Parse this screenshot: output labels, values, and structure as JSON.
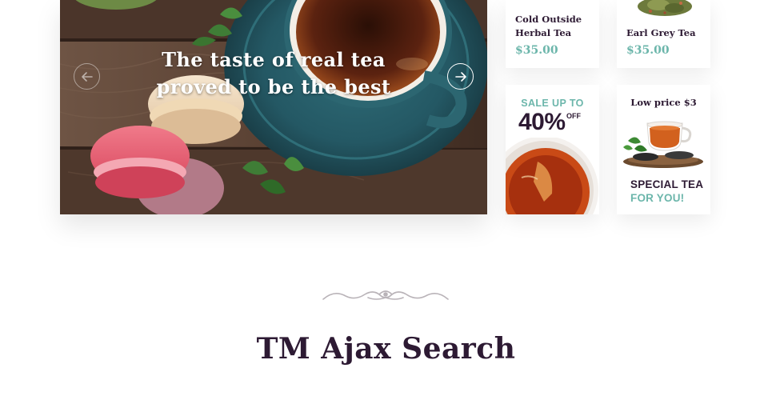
{
  "slider": {
    "caption_line1": "The taste of real tea",
    "caption_line2": "proved to be the best",
    "prev_icon": "arrow-left-icon",
    "next_icon": "arrow-right-icon"
  },
  "products": [
    {
      "name_line1": "Cold Outside",
      "name_line2": "Herbal Tea",
      "price": "$35.00"
    },
    {
      "name_line1": "",
      "name_line2": "Earl Grey Tea",
      "price": "$35.00"
    }
  ],
  "promo_sale": {
    "line": "SALE UP TO",
    "big": "40%",
    "off": "OFF"
  },
  "promo_special": {
    "headline": "Low price $3",
    "line1": "SPECIAL TEA",
    "line2": "FOR YOU!"
  },
  "section": {
    "title": "TM Ajax Search",
    "ornament_icon": "ornament-divider-icon"
  },
  "colors": {
    "accent": "#6cb6ab",
    "dark": "#2d1a33",
    "wood": "#4a3428"
  }
}
